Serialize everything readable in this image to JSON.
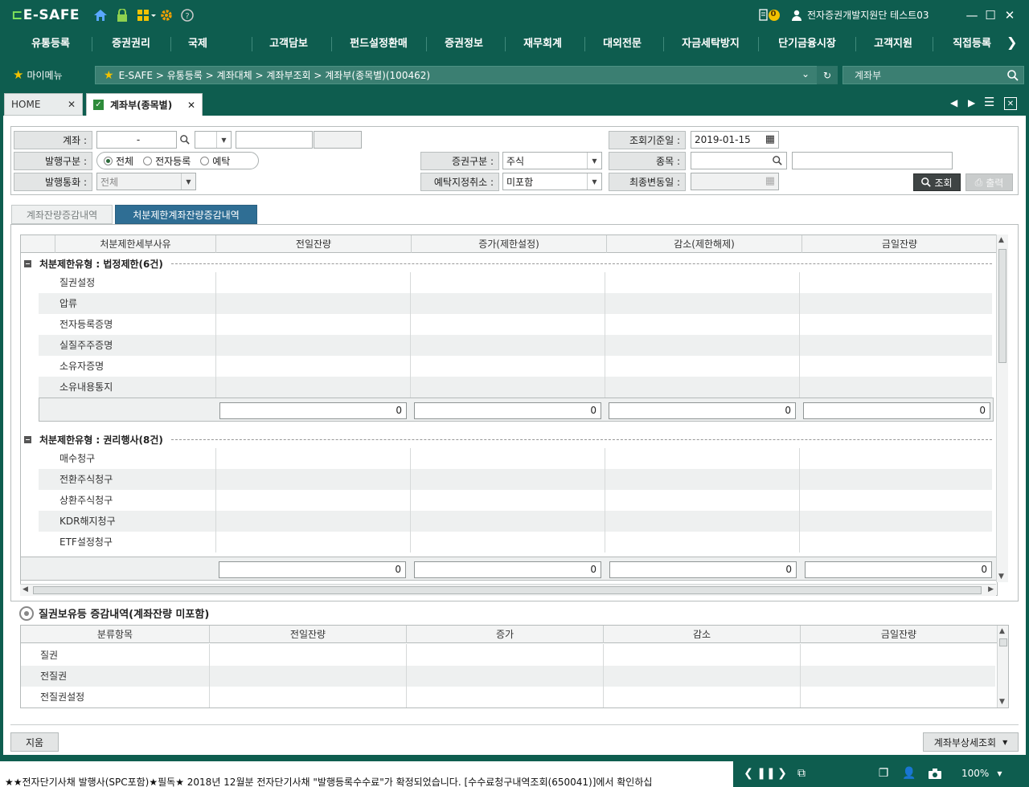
{
  "app": {
    "logo": "E-SAFE",
    "user": "전자증권개발지원단 테스트03",
    "badge_count": "0"
  },
  "menu": [
    "유통등록",
    "증권권리",
    "국제",
    "고객담보",
    "펀드설정환매",
    "증권정보",
    "재무회계",
    "대외전문",
    "자금세탁방지",
    "단기금융시장",
    "고객지원",
    "직접등록"
  ],
  "nav": {
    "mymenu": "마이메뉴",
    "breadcrumb": "E-SAFE  >  유통등록  >  계좌대체  >  계좌부조회  >  계좌부(종목별)(100462)",
    "search_value": "계좌부"
  },
  "tabs": {
    "home": "HOME",
    "active": "계좌부(종목별)"
  },
  "filters": {
    "account_label": "계좌 :",
    "account_value": "-",
    "issue_type_label": "발행구분 :",
    "issue_options": [
      "전체",
      "전자등록",
      "예탁"
    ],
    "issue_selected": "전체",
    "currency_label": "발행통화 :",
    "currency_value": "전체",
    "sec_type_label": "증권구분 :",
    "sec_type_value": "주식",
    "deposit_cancel_label": "예탁지정취소 :",
    "deposit_cancel_value": "미포함",
    "ref_date_label": "조회기준일 :",
    "ref_date_value": "2019-01-15",
    "item_label": "종목 :",
    "last_change_label": "최종변동일 :",
    "search_btn": "조회",
    "print_btn": "출력"
  },
  "subtabs": [
    "계좌잔량증감내역",
    "처분제한계좌잔량증감내역"
  ],
  "grid1": {
    "headers": [
      "처분제한세부사유",
      "전일잔량",
      "증가(제한설정)",
      "감소(제한해제)",
      "금일잔량"
    ],
    "groups": [
      {
        "title": "처분제한유형 : 법정제한(6건)",
        "rows": [
          "질권설정",
          "압류",
          "전자등록증명",
          "실질주주증명",
          "소유자증명",
          "소유내용통지"
        ],
        "sums": [
          "0",
          "0",
          "0",
          "0"
        ]
      },
      {
        "title": "처분제한유형 : 권리행사(8건)",
        "rows": [
          "매수청구",
          "전환주식청구",
          "상환주식청구",
          "KDR해지청구",
          "ETF설정청구"
        ],
        "sums": [
          "0",
          "0",
          "0",
          "0"
        ]
      }
    ]
  },
  "section2": {
    "title": "질권보유등 증감내역(계좌잔량 미포함)"
  },
  "grid2": {
    "headers": [
      "분류항목",
      "전일잔량",
      "증가",
      "감소",
      "금일잔량"
    ],
    "rows": [
      "질권",
      "전질권",
      "전질권설정"
    ]
  },
  "bottom": {
    "clear_btn": "지움",
    "detail_btn": "계좌부상세조회"
  },
  "status": {
    "ticker": "★★전자단기사채  발행사(SPC포함)★필독★  2018년  12월분  전자단기사채  \"발행등록수수료\"가  확정되었습니다.  [수수료청구내역조회(650041)]에서  확인하십",
    "zoom": "100%"
  }
}
